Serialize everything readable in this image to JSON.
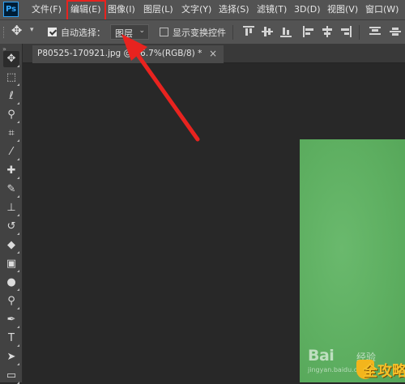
{
  "app": {
    "logo_text": "Ps"
  },
  "menubar": {
    "items": [
      "文件(F)",
      "编辑(E)",
      "图像(I)",
      "图层(L)",
      "文字(Y)",
      "选择(S)",
      "滤镜(T)",
      "3D(D)",
      "视图(V)",
      "窗口(W)"
    ],
    "highlighted_item": "编辑(E)"
  },
  "options_bar": {
    "auto_select_checked": true,
    "auto_select_label": "自动选择：",
    "auto_select_target": "图层",
    "show_transform_checked": false,
    "show_transform_label": "显示变换控件"
  },
  "document": {
    "tab_title": "P80525-170921.jpg @ 66.7%(RGB/8) *",
    "close_glyph": "×"
  },
  "toolbar": {
    "tools": [
      "move-tool",
      "marquee-tool",
      "lasso-tool",
      "quick-select-tool",
      "crop-tool",
      "eyedropper-tool",
      "healing-brush-tool",
      "brush-tool",
      "clone-stamp-tool",
      "history-brush-tool",
      "eraser-tool",
      "gradient-tool",
      "blur-tool",
      "dodge-tool",
      "pen-tool",
      "type-tool",
      "path-select-tool"
    ]
  },
  "watermark": {
    "baidu": "Bai",
    "jingyan": "经验",
    "url": "jingyan.baidu.com",
    "site_logo_text": "全攻略"
  },
  "colors": {
    "annotation_red": "#e8231f",
    "canvas_green": "#5eaf61",
    "ui_dark": "#535353"
  }
}
